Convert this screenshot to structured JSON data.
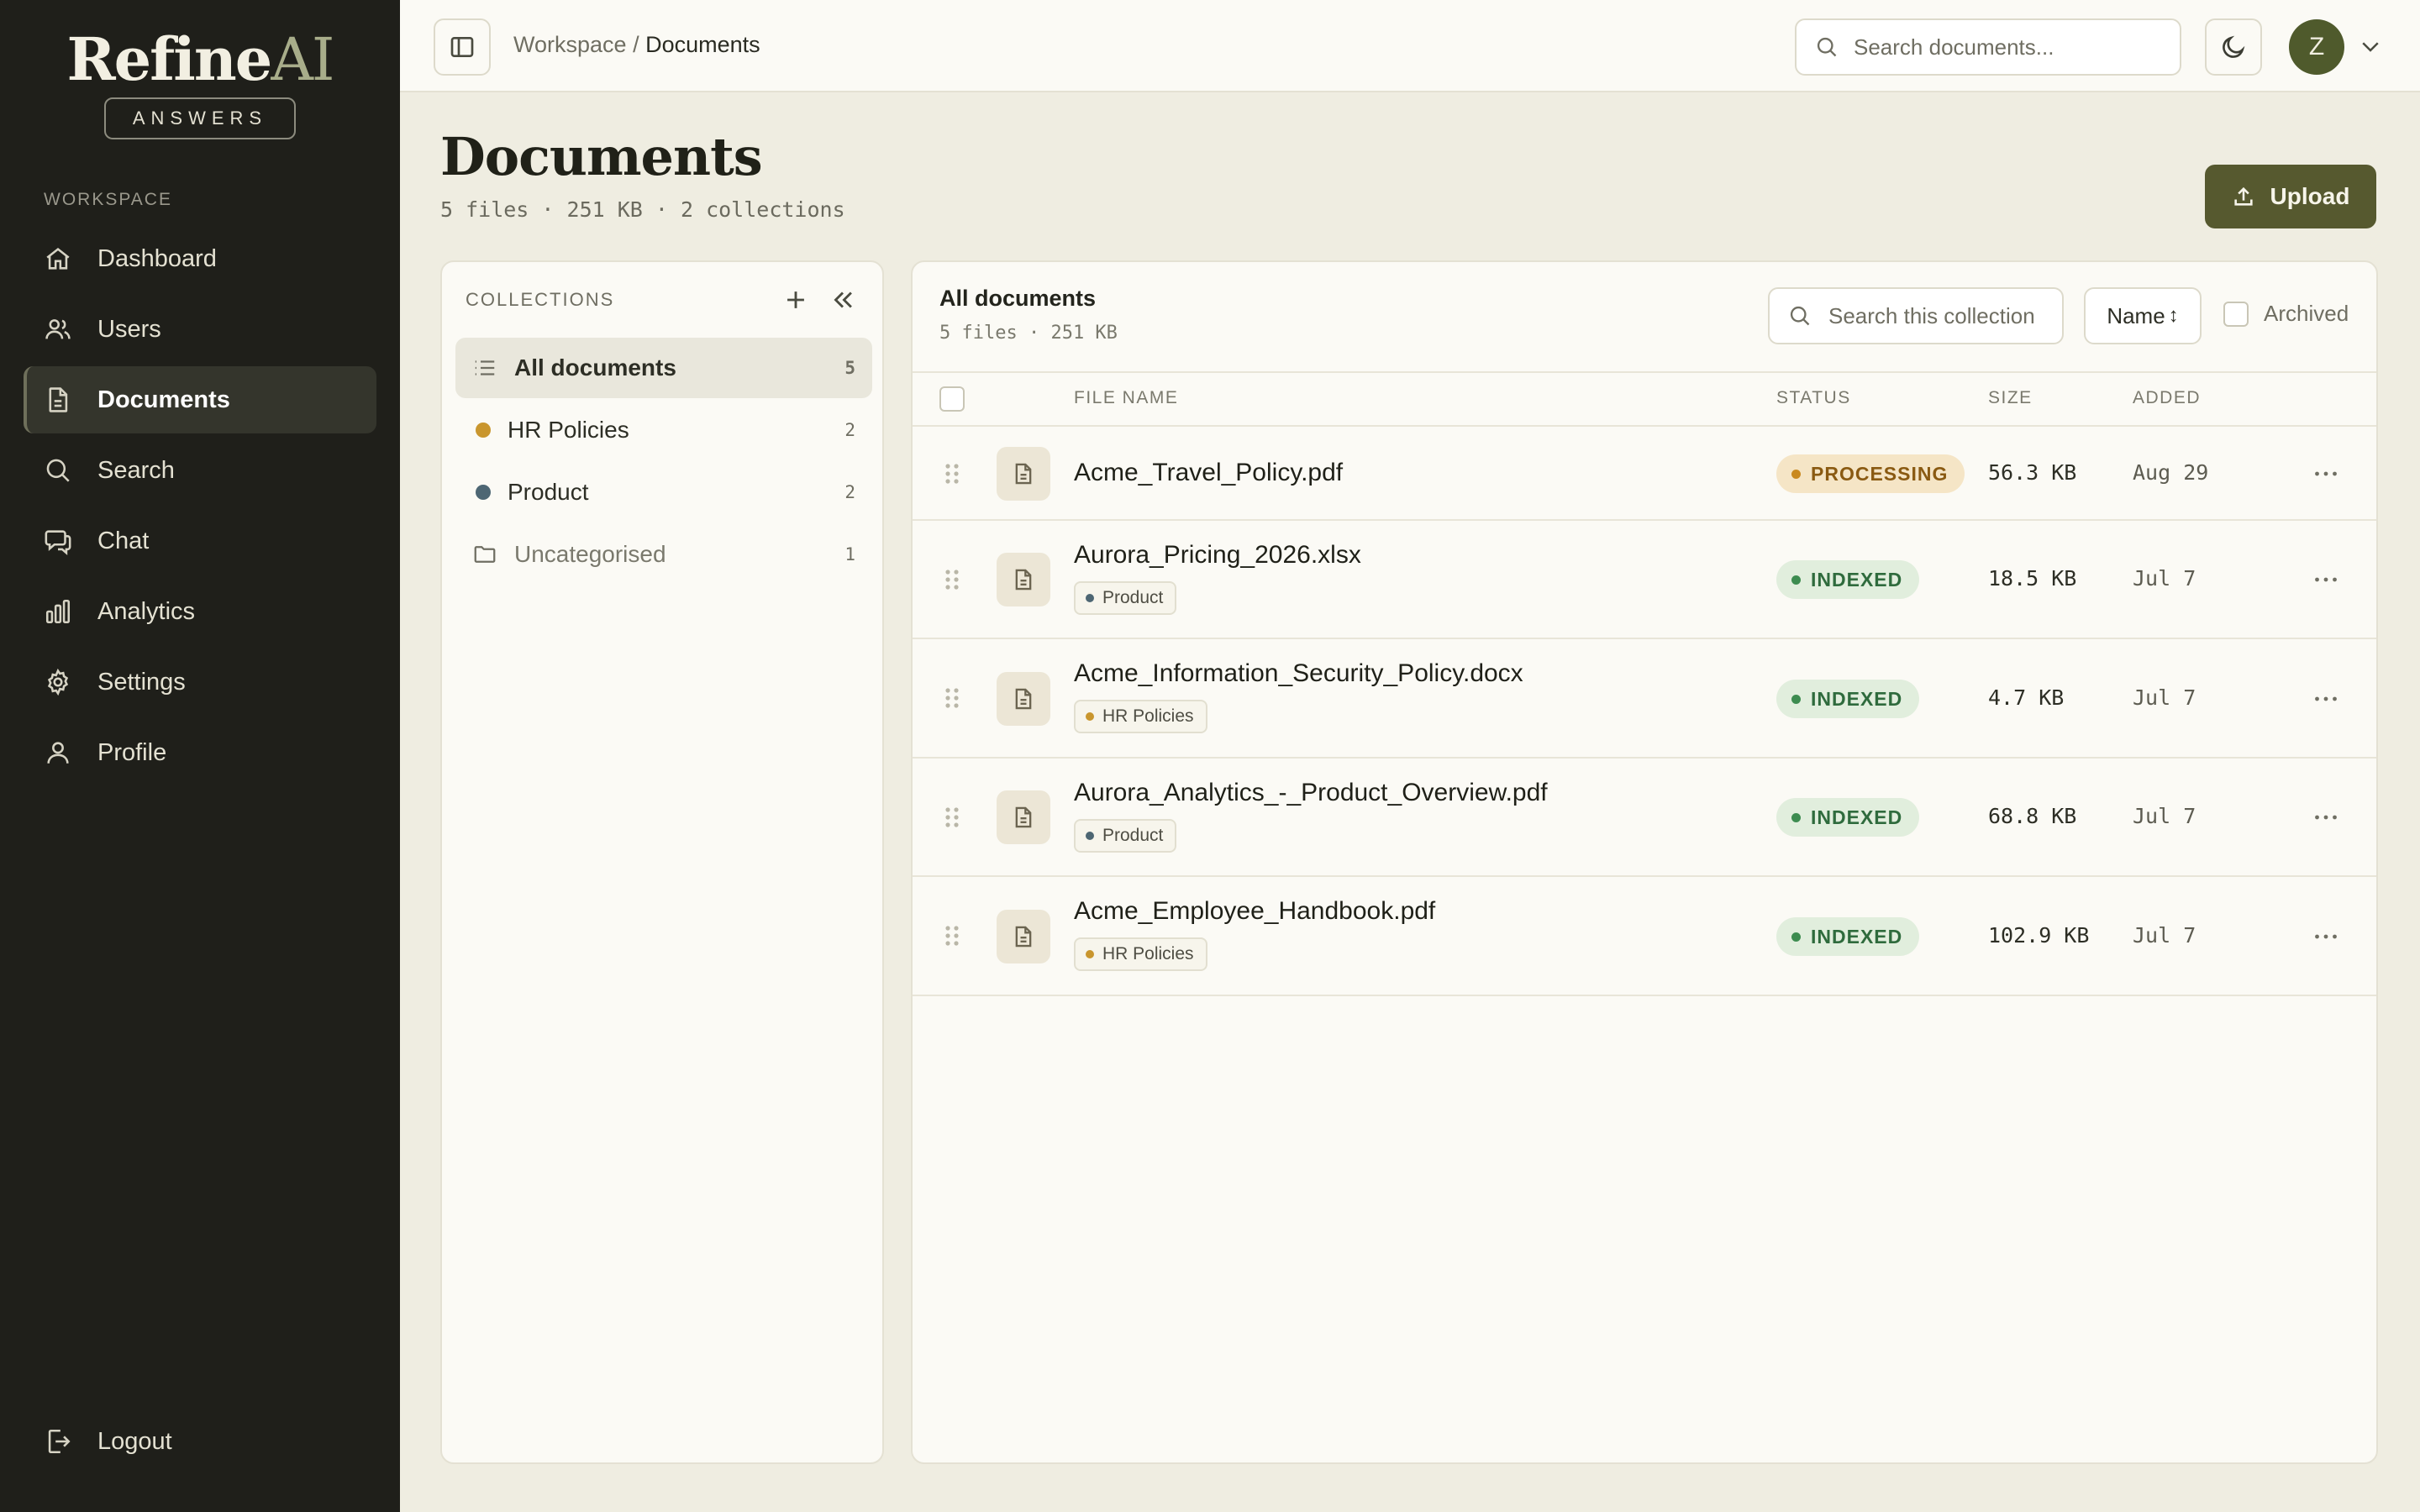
{
  "brand": {
    "name_main": "Refine",
    "name_accent": "AI",
    "subtitle": "ANSWERS"
  },
  "sidebar": {
    "section_label": "WORKSPACE",
    "items": [
      {
        "label": "Dashboard",
        "icon": "home-icon",
        "active": false
      },
      {
        "label": "Users",
        "icon": "users-icon",
        "active": false
      },
      {
        "label": "Documents",
        "icon": "document-icon",
        "active": true
      },
      {
        "label": "Search",
        "icon": "search-icon",
        "active": false
      },
      {
        "label": "Chat",
        "icon": "chat-icon",
        "active": false
      },
      {
        "label": "Analytics",
        "icon": "bar-chart-icon",
        "active": false
      },
      {
        "label": "Settings",
        "icon": "gear-icon",
        "active": false
      },
      {
        "label": "Profile",
        "icon": "user-icon",
        "active": false
      }
    ],
    "logout_label": "Logout"
  },
  "topbar": {
    "breadcrumb_parent": "Workspace",
    "breadcrumb_sep": " / ",
    "breadcrumb_current": "Documents",
    "search_placeholder": "Search documents...",
    "avatar_initial": "Z"
  },
  "page": {
    "title": "Documents",
    "meta": "5 files · 251 KB · 2 collections",
    "upload_label": "Upload"
  },
  "collections": {
    "header": "COLLECTIONS",
    "items": [
      {
        "label": "All documents",
        "count": "5",
        "active": true,
        "icon": "list-icon"
      },
      {
        "label": "HR Policies",
        "count": "2",
        "active": false,
        "dot_color": "#c9962e"
      },
      {
        "label": "Product",
        "count": "2",
        "active": false,
        "dot_color": "#4d6673"
      },
      {
        "label": "Uncategorised",
        "count": "1",
        "active": false,
        "icon": "folder-icon"
      }
    ]
  },
  "docs": {
    "title": "All documents",
    "meta": "5 files · 251 KB",
    "search_placeholder": "Search this collection",
    "sort_label": "Name",
    "archived_label": "Archived",
    "columns": {
      "file_name": "FILE NAME",
      "status": "STATUS",
      "size": "SIZE",
      "added": "ADDED"
    },
    "rows": [
      {
        "name": "Acme_Travel_Policy.pdf",
        "tag": "",
        "status": "PROCESSING",
        "size": "56.3 KB",
        "added": "Aug 29"
      },
      {
        "name": "Aurora_Pricing_2026.xlsx",
        "tag": "Product",
        "tag_color": "#4d6673",
        "status": "INDEXED",
        "size": "18.5 KB",
        "added": "Jul 7"
      },
      {
        "name": "Acme_Information_Security_Policy.docx",
        "tag": "HR Policies",
        "tag_color": "#c9962e",
        "status": "INDEXED",
        "size": "4.7 KB",
        "added": "Jul 7"
      },
      {
        "name": "Aurora_Analytics_-_Product_Overview.pdf",
        "tag": "Product",
        "tag_color": "#4d6673",
        "status": "INDEXED",
        "size": "68.8 KB",
        "added": "Jul 7"
      },
      {
        "name": "Acme_Employee_Handbook.pdf",
        "tag": "HR Policies",
        "tag_color": "#c9962e",
        "status": "INDEXED",
        "size": "102.9 KB",
        "added": "Jul 7"
      }
    ]
  },
  "colors": {
    "sidebar_bg": "#1f1f1a",
    "accent": "#56592f",
    "avatar": "#4f5a2c",
    "processing": "#c9891f",
    "indexed": "#3d8c50"
  }
}
